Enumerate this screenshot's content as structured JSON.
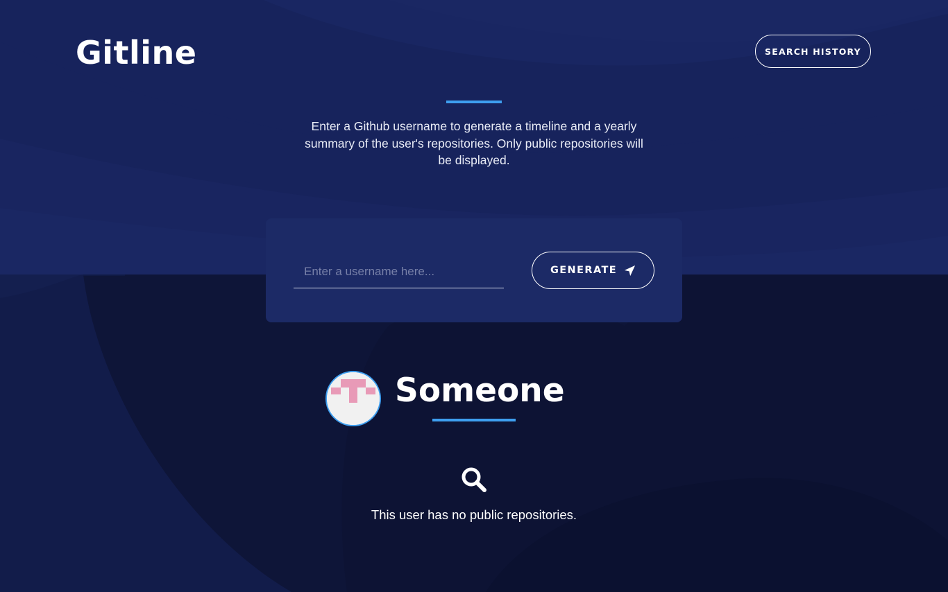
{
  "app": {
    "logo_text": "Gitline"
  },
  "header": {
    "history_button_label": "SEARCH HISTORY"
  },
  "intro": {
    "text": "Enter a Github username to generate a timeline and a yearly summary of the user's repositories. Only public repositories will be displayed."
  },
  "search": {
    "placeholder": "Enter a username here...",
    "value": "",
    "generate_label": "GENERATE",
    "generate_icon": "location-arrow-icon"
  },
  "profile": {
    "username": "Someone",
    "avatar": "identicon-avatar"
  },
  "empty_state": {
    "icon": "search-icon",
    "message": "This user has no public repositories."
  },
  "colors": {
    "background": "#0f1840",
    "panel": "#1c2a66",
    "accent": "#3e9ff0",
    "avatar_identicon": "#e89ab7"
  }
}
